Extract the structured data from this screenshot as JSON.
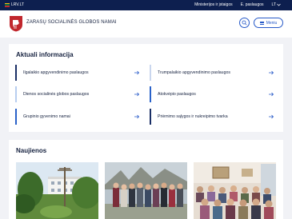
{
  "topbar": {
    "brand": "LRV.LT",
    "links": [
      "Ministerijos ir įstaigos",
      "E. paslaugos"
    ],
    "language": "LT"
  },
  "header": {
    "title": "ZARASŲ SOCIALINĖS GLOBOS NAMAI",
    "menu_label": "Meniu"
  },
  "info": {
    "title": "Aktuali informacija",
    "items": [
      {
        "label": "Ilgalaikio apgyvendinimo paslaugos",
        "bar_color": "#1a2f66"
      },
      {
        "label": "Trumpalaikio apgyvendinimo paslaugos",
        "bar_color": "#2a62c9"
      },
      {
        "label": "Dienos socialinės globos paslaugos",
        "bar_color": "#b7cdf0"
      },
      {
        "label": "Atokvėpio paslaugos",
        "bar_color": "#2a62c9"
      },
      {
        "label": "Grupinio gyvenimo namai",
        "bar_color": "#2a62c9"
      },
      {
        "label": "Priėmimo sąlygos ir nukreipimo tvarka",
        "bar_color": "#1a2f66"
      }
    ]
  },
  "news": {
    "title": "Naujienos"
  },
  "colors": {
    "navy": "#0d1f4f",
    "accent": "#2659c8"
  }
}
